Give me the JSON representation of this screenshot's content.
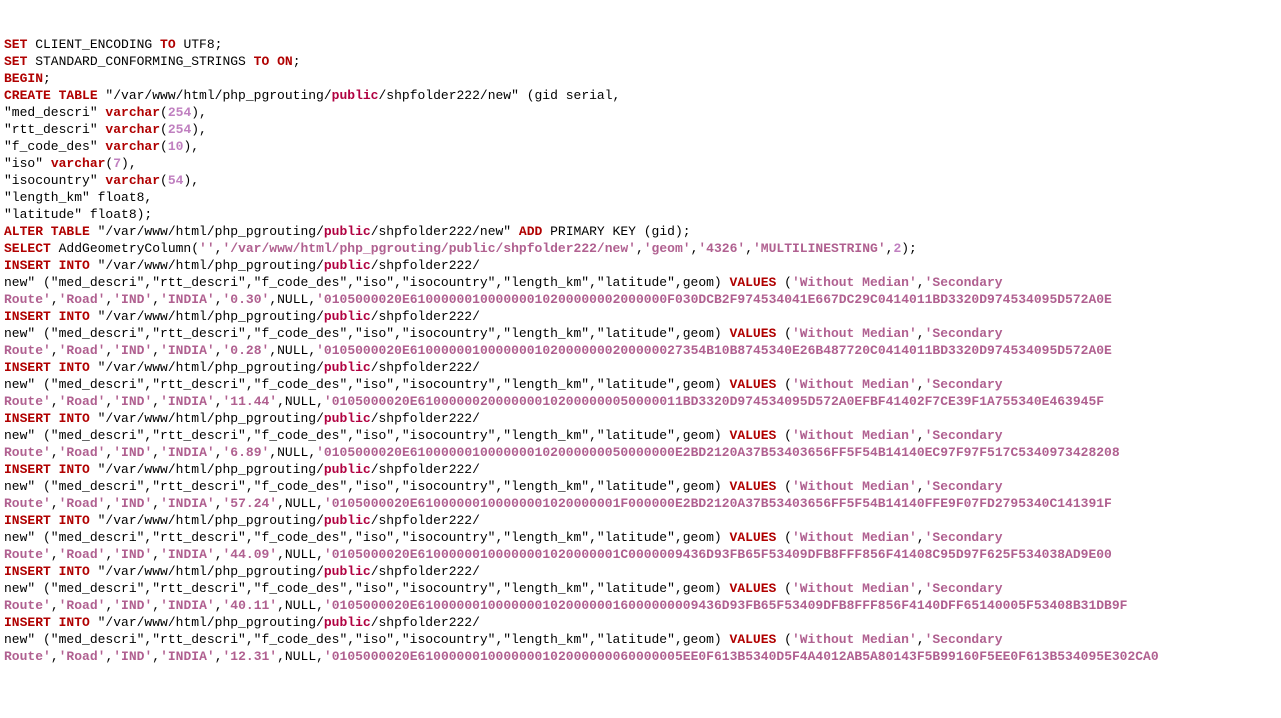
{
  "lines": [
    [
      {
        "c": "kw-red",
        "t": "SET"
      },
      {
        "c": "",
        "t": " CLIENT_ENCODING "
      },
      {
        "c": "kw-red",
        "t": "TO"
      },
      {
        "c": "",
        "t": " UTF8;"
      }
    ],
    [
      {
        "c": "kw-red",
        "t": "SET"
      },
      {
        "c": "",
        "t": " STANDARD_CONFORMING_STRINGS "
      },
      {
        "c": "kw-red",
        "t": "TO"
      },
      {
        "c": "",
        "t": " "
      },
      {
        "c": "kw-red",
        "t": "ON"
      },
      {
        "c": "",
        "t": ";"
      }
    ],
    [
      {
        "c": "kw-red",
        "t": "BEGIN"
      },
      {
        "c": "",
        "t": ";"
      }
    ],
    [
      {
        "c": "kw-red",
        "t": "CREATE TABLE"
      },
      {
        "c": "",
        "t": " \"/var/www/html/php_pgrouting/"
      },
      {
        "c": "public",
        "t": "public"
      },
      {
        "c": "",
        "t": "/shpfolder222/new\" (gid serial,"
      }
    ],
    [
      {
        "c": "",
        "t": "\"med_descri\" "
      },
      {
        "c": "varchar",
        "t": "varchar"
      },
      {
        "c": "",
        "t": "("
      },
      {
        "c": "num",
        "t": "254"
      },
      {
        "c": "",
        "t": "),"
      }
    ],
    [
      {
        "c": "",
        "t": "\"rtt_descri\" "
      },
      {
        "c": "varchar",
        "t": "varchar"
      },
      {
        "c": "",
        "t": "("
      },
      {
        "c": "num",
        "t": "254"
      },
      {
        "c": "",
        "t": "),"
      }
    ],
    [
      {
        "c": "",
        "t": "\"f_code_des\" "
      },
      {
        "c": "varchar",
        "t": "varchar"
      },
      {
        "c": "",
        "t": "("
      },
      {
        "c": "num",
        "t": "10"
      },
      {
        "c": "",
        "t": "),"
      }
    ],
    [
      {
        "c": "",
        "t": "\"iso\" "
      },
      {
        "c": "varchar",
        "t": "varchar"
      },
      {
        "c": "",
        "t": "("
      },
      {
        "c": "num",
        "t": "7"
      },
      {
        "c": "",
        "t": "),"
      }
    ],
    [
      {
        "c": "",
        "t": "\"isocountry\" "
      },
      {
        "c": "varchar",
        "t": "varchar"
      },
      {
        "c": "",
        "t": "("
      },
      {
        "c": "num",
        "t": "54"
      },
      {
        "c": "",
        "t": "),"
      }
    ],
    [
      {
        "c": "",
        "t": "\"length_km\" float8,"
      }
    ],
    [
      {
        "c": "",
        "t": "\"latitude\" float8);"
      }
    ],
    [
      {
        "c": "kw-red",
        "t": "ALTER TABLE"
      },
      {
        "c": "",
        "t": " \"/var/www/html/php_pgrouting/"
      },
      {
        "c": "public",
        "t": "public"
      },
      {
        "c": "",
        "t": "/shpfolder222/new\" "
      },
      {
        "c": "kw-red",
        "t": "ADD"
      },
      {
        "c": "",
        "t": " PRIMARY KEY (gid);"
      }
    ],
    [
      {
        "c": "kw-red",
        "t": "SELECT"
      },
      {
        "c": "",
        "t": " AddGeometryColumn("
      },
      {
        "c": "str",
        "t": "''"
      },
      {
        "c": "",
        "t": ","
      },
      {
        "c": "str",
        "t": "'/var/www/html/php_pgrouting/public/shpfolder222/new'"
      },
      {
        "c": "",
        "t": ","
      },
      {
        "c": "str",
        "t": "'geom'"
      },
      {
        "c": "",
        "t": ","
      },
      {
        "c": "str",
        "t": "'4326'"
      },
      {
        "c": "",
        "t": ","
      },
      {
        "c": "str",
        "t": "'MULTILINESTRING'"
      },
      {
        "c": "",
        "t": ","
      },
      {
        "c": "num",
        "t": "2"
      },
      {
        "c": "",
        "t": ");"
      }
    ],
    [
      {
        "c": "kw-red",
        "t": "INSERT INTO"
      },
      {
        "c": "",
        "t": " \"/var/www/html/php_pgrouting/"
      },
      {
        "c": "public",
        "t": "public"
      },
      {
        "c": "",
        "t": "/shpfolder222/"
      }
    ],
    [
      {
        "c": "",
        "t": "new\" (\"med_descri\",\"rtt_descri\",\"f_code_des\",\"iso\",\"isocountry\",\"length_km\",\"latitude\",geom) "
      },
      {
        "c": "kw-red",
        "t": "VALUES"
      },
      {
        "c": "",
        "t": " ("
      },
      {
        "c": "str",
        "t": "'Without Median'"
      },
      {
        "c": "",
        "t": ","
      },
      {
        "c": "str",
        "t": "'Secondary "
      }
    ],
    [
      {
        "c": "str",
        "t": "Route'"
      },
      {
        "c": "",
        "t": ","
      },
      {
        "c": "str",
        "t": "'Road'"
      },
      {
        "c": "",
        "t": ","
      },
      {
        "c": "str",
        "t": "'IND'"
      },
      {
        "c": "",
        "t": ","
      },
      {
        "c": "str",
        "t": "'INDIA'"
      },
      {
        "c": "",
        "t": ","
      },
      {
        "c": "str",
        "t": "'0.30'"
      },
      {
        "c": "",
        "t": ",NULL,"
      },
      {
        "c": "str",
        "t": "'0105000020E610000001000000010200000002000000F030DCB2F974534041E667DC29C0414011BD3320D974534095D572A0E"
      }
    ],
    [
      {
        "c": "kw-red",
        "t": "INSERT INTO"
      },
      {
        "c": "",
        "t": " \"/var/www/html/php_pgrouting/"
      },
      {
        "c": "public",
        "t": "public"
      },
      {
        "c": "",
        "t": "/shpfolder222/"
      }
    ],
    [
      {
        "c": "",
        "t": "new\" (\"med_descri\",\"rtt_descri\",\"f_code_des\",\"iso\",\"isocountry\",\"length_km\",\"latitude\",geom) "
      },
      {
        "c": "kw-red",
        "t": "VALUES"
      },
      {
        "c": "",
        "t": " ("
      },
      {
        "c": "str",
        "t": "'Without Median'"
      },
      {
        "c": "",
        "t": ","
      },
      {
        "c": "str",
        "t": "'Secondary "
      }
    ],
    [
      {
        "c": "str",
        "t": "Route'"
      },
      {
        "c": "",
        "t": ","
      },
      {
        "c": "str",
        "t": "'Road'"
      },
      {
        "c": "",
        "t": ","
      },
      {
        "c": "str",
        "t": "'IND'"
      },
      {
        "c": "",
        "t": ","
      },
      {
        "c": "str",
        "t": "'INDIA'"
      },
      {
        "c": "",
        "t": ","
      },
      {
        "c": "str",
        "t": "'0.28'"
      },
      {
        "c": "",
        "t": ",NULL,"
      },
      {
        "c": "str",
        "t": "'0105000020E61000000100000001020000000200000027354B10B8745340E26B487720C0414011BD3320D974534095D572A0E"
      }
    ],
    [
      {
        "c": "kw-red",
        "t": "INSERT INTO"
      },
      {
        "c": "",
        "t": " \"/var/www/html/php_pgrouting/"
      },
      {
        "c": "public",
        "t": "public"
      },
      {
        "c": "",
        "t": "/shpfolder222/"
      }
    ],
    [
      {
        "c": "",
        "t": "new\" (\"med_descri\",\"rtt_descri\",\"f_code_des\",\"iso\",\"isocountry\",\"length_km\",\"latitude\",geom) "
      },
      {
        "c": "kw-red",
        "t": "VALUES"
      },
      {
        "c": "",
        "t": " ("
      },
      {
        "c": "str",
        "t": "'Without Median'"
      },
      {
        "c": "",
        "t": ","
      },
      {
        "c": "str",
        "t": "'Secondary "
      }
    ],
    [
      {
        "c": "str",
        "t": "Route'"
      },
      {
        "c": "",
        "t": ","
      },
      {
        "c": "str",
        "t": "'Road'"
      },
      {
        "c": "",
        "t": ","
      },
      {
        "c": "str",
        "t": "'IND'"
      },
      {
        "c": "",
        "t": ","
      },
      {
        "c": "str",
        "t": "'INDIA'"
      },
      {
        "c": "",
        "t": ","
      },
      {
        "c": "str",
        "t": "'11.44'"
      },
      {
        "c": "",
        "t": ",NULL,"
      },
      {
        "c": "str",
        "t": "'0105000020E6100000020000000102000000050000011BD3320D974534095D572A0EFBF41402F7CE39F1A755340E463945F"
      }
    ],
    [
      {
        "c": "kw-red",
        "t": "INSERT INTO"
      },
      {
        "c": "",
        "t": " \"/var/www/html/php_pgrouting/"
      },
      {
        "c": "public",
        "t": "public"
      },
      {
        "c": "",
        "t": "/shpfolder222/"
      }
    ],
    [
      {
        "c": "",
        "t": "new\" (\"med_descri\",\"rtt_descri\",\"f_code_des\",\"iso\",\"isocountry\",\"length_km\",\"latitude\",geom) "
      },
      {
        "c": "kw-red",
        "t": "VALUES"
      },
      {
        "c": "",
        "t": " ("
      },
      {
        "c": "str",
        "t": "'Without Median'"
      },
      {
        "c": "",
        "t": ","
      },
      {
        "c": "str",
        "t": "'Secondary "
      }
    ],
    [
      {
        "c": "str",
        "t": "Route'"
      },
      {
        "c": "",
        "t": ","
      },
      {
        "c": "str",
        "t": "'Road'"
      },
      {
        "c": "",
        "t": ","
      },
      {
        "c": "str",
        "t": "'IND'"
      },
      {
        "c": "",
        "t": ","
      },
      {
        "c": "str",
        "t": "'INDIA'"
      },
      {
        "c": "",
        "t": ","
      },
      {
        "c": "str",
        "t": "'6.89'"
      },
      {
        "c": "",
        "t": ",NULL,"
      },
      {
        "c": "str",
        "t": "'0105000020E6100000010000000102000000050000000E2BD2120A37B53403656FF5F54B14140EC97F97F517C5340973428208"
      }
    ],
    [
      {
        "c": "kw-red",
        "t": "INSERT INTO"
      },
      {
        "c": "",
        "t": " \"/var/www/html/php_pgrouting/"
      },
      {
        "c": "public",
        "t": "public"
      },
      {
        "c": "",
        "t": "/shpfolder222/"
      }
    ],
    [
      {
        "c": "",
        "t": "new\" (\"med_descri\",\"rtt_descri\",\"f_code_des\",\"iso\",\"isocountry\",\"length_km\",\"latitude\",geom) "
      },
      {
        "c": "kw-red",
        "t": "VALUES"
      },
      {
        "c": "",
        "t": " ("
      },
      {
        "c": "str",
        "t": "'Without Median'"
      },
      {
        "c": "",
        "t": ","
      },
      {
        "c": "str",
        "t": "'Secondary "
      }
    ],
    [
      {
        "c": "str",
        "t": "Route'"
      },
      {
        "c": "",
        "t": ","
      },
      {
        "c": "str",
        "t": "'Road'"
      },
      {
        "c": "",
        "t": ","
      },
      {
        "c": "str",
        "t": "'IND'"
      },
      {
        "c": "",
        "t": ","
      },
      {
        "c": "str",
        "t": "'INDIA'"
      },
      {
        "c": "",
        "t": ","
      },
      {
        "c": "str",
        "t": "'57.24'"
      },
      {
        "c": "",
        "t": ",NULL,"
      },
      {
        "c": "str",
        "t": "'0105000020E61000000100000001020000001F000000E2BD2120A37B53403656FF5F54B14140FFE9F07FD2795340C141391F"
      }
    ],
    [
      {
        "c": "kw-red",
        "t": "INSERT INTO"
      },
      {
        "c": "",
        "t": " \"/var/www/html/php_pgrouting/"
      },
      {
        "c": "public",
        "t": "public"
      },
      {
        "c": "",
        "t": "/shpfolder222/"
      }
    ],
    [
      {
        "c": "",
        "t": "new\" (\"med_descri\",\"rtt_descri\",\"f_code_des\",\"iso\",\"isocountry\",\"length_km\",\"latitude\",geom) "
      },
      {
        "c": "kw-red",
        "t": "VALUES"
      },
      {
        "c": "",
        "t": " ("
      },
      {
        "c": "str",
        "t": "'Without Median'"
      },
      {
        "c": "",
        "t": ","
      },
      {
        "c": "str",
        "t": "'Secondary "
      }
    ],
    [
      {
        "c": "str",
        "t": "Route'"
      },
      {
        "c": "",
        "t": ","
      },
      {
        "c": "str",
        "t": "'Road'"
      },
      {
        "c": "",
        "t": ","
      },
      {
        "c": "str",
        "t": "'IND'"
      },
      {
        "c": "",
        "t": ","
      },
      {
        "c": "str",
        "t": "'INDIA'"
      },
      {
        "c": "",
        "t": ","
      },
      {
        "c": "str",
        "t": "'44.09'"
      },
      {
        "c": "",
        "t": ",NULL,"
      },
      {
        "c": "str",
        "t": "'0105000020E61000000100000001020000001C0000009436D93FB65F53409DFB8FFF856F41408C95D97F625F534038AD9E00"
      }
    ],
    [
      {
        "c": "kw-red",
        "t": "INSERT INTO"
      },
      {
        "c": "",
        "t": " \"/var/www/html/php_pgrouting/"
      },
      {
        "c": "public",
        "t": "public"
      },
      {
        "c": "",
        "t": "/shpfolder222/"
      }
    ],
    [
      {
        "c": "",
        "t": "new\" (\"med_descri\",\"rtt_descri\",\"f_code_des\",\"iso\",\"isocountry\",\"length_km\",\"latitude\",geom) "
      },
      {
        "c": "kw-red",
        "t": "VALUES"
      },
      {
        "c": "",
        "t": " ("
      },
      {
        "c": "str",
        "t": "'Without Median'"
      },
      {
        "c": "",
        "t": ","
      },
      {
        "c": "str",
        "t": "'Secondary "
      }
    ],
    [
      {
        "c": "str",
        "t": "Route'"
      },
      {
        "c": "",
        "t": ","
      },
      {
        "c": "str",
        "t": "'Road'"
      },
      {
        "c": "",
        "t": ","
      },
      {
        "c": "str",
        "t": "'IND'"
      },
      {
        "c": "",
        "t": ","
      },
      {
        "c": "str",
        "t": "'INDIA'"
      },
      {
        "c": "",
        "t": ","
      },
      {
        "c": "str",
        "t": "'40.11'"
      },
      {
        "c": "",
        "t": ",NULL,"
      },
      {
        "c": "str",
        "t": "'0105000020E610000001000000010200000016000000009436D93FB65F53409DFB8FFF856F4140DFF65140005F53408B31DB9F"
      }
    ],
    [
      {
        "c": "kw-red",
        "t": "INSERT INTO"
      },
      {
        "c": "",
        "t": " \"/var/www/html/php_pgrouting/"
      },
      {
        "c": "public",
        "t": "public"
      },
      {
        "c": "",
        "t": "/shpfolder222/"
      }
    ],
    [
      {
        "c": "",
        "t": "new\" (\"med_descri\",\"rtt_descri\",\"f_code_des\",\"iso\",\"isocountry\",\"length_km\",\"latitude\",geom) "
      },
      {
        "c": "kw-red",
        "t": "VALUES"
      },
      {
        "c": "",
        "t": " ("
      },
      {
        "c": "str",
        "t": "'Without Median'"
      },
      {
        "c": "",
        "t": ","
      },
      {
        "c": "str",
        "t": "'Secondary "
      }
    ],
    [
      {
        "c": "str",
        "t": "Route'"
      },
      {
        "c": "",
        "t": ","
      },
      {
        "c": "str",
        "t": "'Road'"
      },
      {
        "c": "",
        "t": ","
      },
      {
        "c": "str",
        "t": "'IND'"
      },
      {
        "c": "",
        "t": ","
      },
      {
        "c": "str",
        "t": "'INDIA'"
      },
      {
        "c": "",
        "t": ","
      },
      {
        "c": "str",
        "t": "'12.31'"
      },
      {
        "c": "",
        "t": ",NULL,"
      },
      {
        "c": "str",
        "t": "'0105000020E6100000010000000102000000060000005EE0F613B5340D5F4A4012AB5A80143F5B99160F5EE0F613B534095E302CA0"
      }
    ]
  ]
}
